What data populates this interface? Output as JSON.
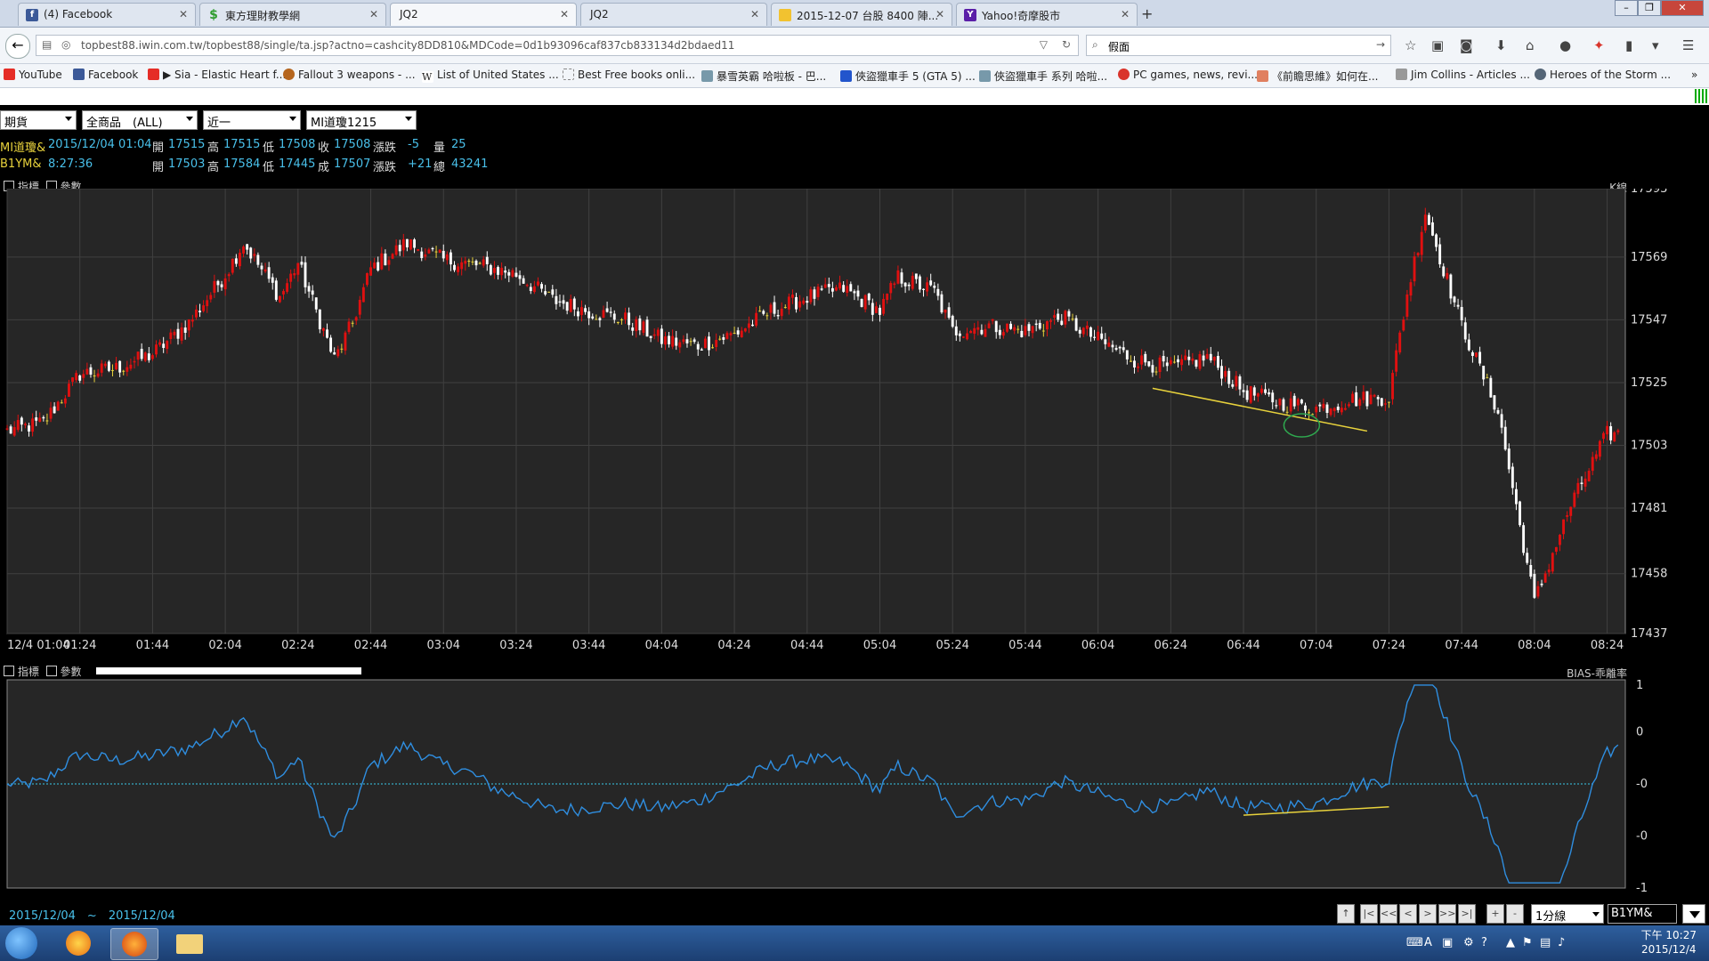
{
  "browser": {
    "tabs": [
      {
        "title": "(4) Facebook",
        "icon": "facebook-icon",
        "color": "#3b5998",
        "glyph": "f"
      },
      {
        "title": "東方理財教學網",
        "icon": "dollar-icon",
        "color": "#2e9c2e",
        "glyph": "$"
      },
      {
        "title": "JQ2",
        "icon": "",
        "color": "",
        "glyph": "",
        "active": true
      },
      {
        "title": "JQ2",
        "icon": "",
        "color": "",
        "glyph": ""
      },
      {
        "title": "2015-12-07 台股 8400 陣...",
        "icon": "folder-icon",
        "color": "#f2c230",
        "glyph": ""
      },
      {
        "title": "Yahoo!奇摩股市",
        "icon": "yahoo-icon",
        "color": "#5b1fa8",
        "glyph": "Y"
      }
    ],
    "url": "topbest88.iwin.com.tw/topbest88/single/ta.jsp?actno=cashcity8DD810&MDCode=0d1b93096caf837cb833134d2bdaed11",
    "search_value": "假面",
    "bookmarks": [
      {
        "label": "YouTube",
        "color": "#e52d27"
      },
      {
        "label": "Facebook",
        "color": "#3b5998"
      },
      {
        "label": "▶ Sia - Elastic Heart f...",
        "color": "#e52d27"
      },
      {
        "label": "Fallout 3 weapons - ...",
        "color": "#b5651d"
      },
      {
        "label": "List of United States ...",
        "color": "#ffffff"
      },
      {
        "label": "Best Free books onli...",
        "color": "#dddddd"
      },
      {
        "label": "暴雪英霸 哈啦板 - 巴...",
        "color": "#7799aa"
      },
      {
        "label": "俠盜獵車手 5 (GTA 5) ...",
        "color": "#2255cc"
      },
      {
        "label": "俠盜獵車手 系列 哈啦...",
        "color": "#7799aa"
      },
      {
        "label": "PC games, news, revi...",
        "color": "#d9342b"
      },
      {
        "label": "《前瞻思維》如何在...",
        "color": "#e08060"
      },
      {
        "label": "Jim Collins - Articles ...",
        "color": "#999999"
      },
      {
        "label": "Heroes of the Storm ...",
        "color": "#556677"
      }
    ]
  },
  "app": {
    "selectors": [
      "期貨",
      "全商品　(ALL)",
      "近一",
      "MI道瓊1215"
    ],
    "quote1": {
      "sym": "MI道瓊&",
      "datetime": "2015/12/04 01:04",
      "open_l": "開",
      "open": "17515",
      "high_l": "高",
      "high": "17515",
      "low_l": "低",
      "low": "17508",
      "close_l": "收",
      "close": "17508",
      "chg_l": "漲跌",
      "chg": "-5",
      "vol_l": "量",
      "vol": "25"
    },
    "quote2": {
      "sym": "B1YM&",
      "datetime": "8:27:36",
      "open_l": "開",
      "open": "17503",
      "high_l": "高",
      "high": "17584",
      "low_l": "低",
      "low": "17445",
      "close_l": "成",
      "close": "17507",
      "chg_l": "漲跌",
      "chg": "+21",
      "vol_l": "總",
      "vol": "43241"
    },
    "main_panel": {
      "left_label": "指標",
      "param_label": "參數",
      "right_label": "K線"
    },
    "sub_panel": {
      "left_label": "指標",
      "param_label": "參數",
      "right_label": "BIAS-乖離率"
    },
    "date_range": "2015/12/04　~　2015/12/04",
    "nav_buttons": [
      "↑",
      "|<",
      "<<",
      "<",
      ">",
      ">>",
      ">|",
      "+",
      "-"
    ],
    "period": "1分線",
    "symbol_input": "B1YM&"
  },
  "chart_data": [
    {
      "type": "candlestick",
      "title": "K線",
      "y_ticks": [
        17593,
        17569,
        17547,
        17525,
        17503,
        17481,
        17458,
        17437
      ],
      "ylim": [
        17437,
        17593
      ],
      "x_ticks": [
        "12/4 01:04",
        "01:24",
        "01:44",
        "02:04",
        "02:24",
        "02:44",
        "03:04",
        "03:24",
        "03:44",
        "04:04",
        "04:24",
        "04:44",
        "05:04",
        "05:24",
        "05:44",
        "06:04",
        "06:24",
        "06:44",
        "07:04",
        "07:24",
        "07:44",
        "08:04",
        "08:24"
      ],
      "close_path": [
        [
          "01:04",
          17508
        ],
        [
          "01:14",
          17511
        ],
        [
          "01:24",
          17528
        ],
        [
          "01:34",
          17530
        ],
        [
          "01:44",
          17535
        ],
        [
          "01:54",
          17546
        ],
        [
          "02:04",
          17563
        ],
        [
          "02:09",
          17574
        ],
        [
          "02:19",
          17555
        ],
        [
          "02:24",
          17567
        ],
        [
          "02:34",
          17533
        ],
        [
          "02:39",
          17546
        ],
        [
          "02:44",
          17565
        ],
        [
          "02:54",
          17574
        ],
        [
          "03:04",
          17568
        ],
        [
          "03:14",
          17566
        ],
        [
          "03:24",
          17563
        ],
        [
          "03:34",
          17554
        ],
        [
          "03:44",
          17550
        ],
        [
          "03:54",
          17547
        ],
        [
          "04:04",
          17540
        ],
        [
          "04:14",
          17538
        ],
        [
          "04:24",
          17542
        ],
        [
          "04:34",
          17550
        ],
        [
          "04:44",
          17555
        ],
        [
          "04:54",
          17558
        ],
        [
          "05:04",
          17550
        ],
        [
          "05:09",
          17562
        ],
        [
          "05:19",
          17557
        ],
        [
          "05:24",
          17543
        ],
        [
          "05:34",
          17545
        ],
        [
          "05:44",
          17543
        ],
        [
          "05:54",
          17548
        ],
        [
          "06:04",
          17540
        ],
        [
          "06:14",
          17533
        ],
        [
          "06:24",
          17530
        ],
        [
          "06:34",
          17534
        ],
        [
          "06:44",
          17522
        ],
        [
          "06:54",
          17518
        ],
        [
          "07:04",
          17516
        ],
        [
          "07:14",
          17519
        ],
        [
          "07:24",
          17520
        ],
        [
          "07:29",
          17556
        ],
        [
          "07:34",
          17585
        ],
        [
          "07:44",
          17545
        ],
        [
          "07:54",
          17515
        ],
        [
          "08:04",
          17448
        ],
        [
          "08:14",
          17482
        ],
        [
          "08:24",
          17507
        ]
      ],
      "annotations": [
        "yellow trendline 06:19–07:18",
        "green circle near 07:00"
      ]
    },
    {
      "type": "line",
      "title": "BIAS-乖離率",
      "y_ticks": [
        "1",
        "0",
        "-0",
        "-0",
        "-1"
      ],
      "ylim": [
        -1,
        1
      ],
      "reference_line": 0,
      "annotations": [
        "yellow trendline 06:44–07:24"
      ]
    }
  ],
  "colors": {
    "up": "#e01010",
    "down": "#ffffff",
    "doji": "#e8d23c",
    "bias": "#2f8ee0",
    "zero_line": "#38c8e8",
    "grid": "#404040"
  },
  "taskbar": {
    "time": "下午 10:27",
    "date": "2015/12/4"
  }
}
